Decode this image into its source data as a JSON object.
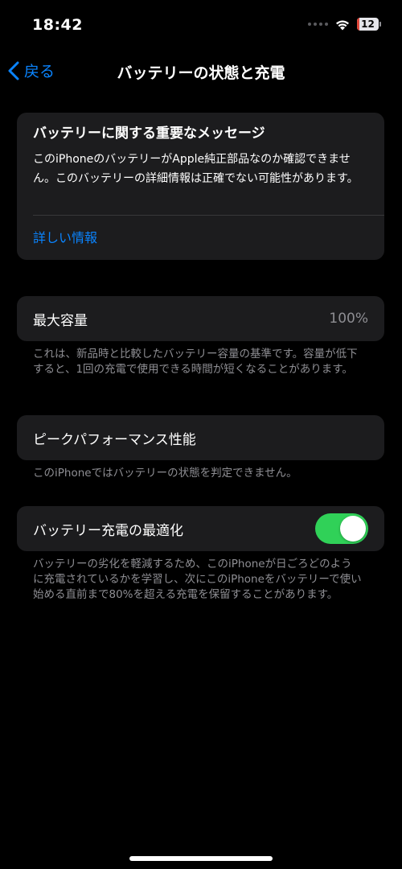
{
  "status_bar": {
    "time": "18:42",
    "battery_level": "12",
    "battery_fraction": 0.12,
    "battery_color": "#e0473a",
    "icons": [
      "cellular-dots-icon",
      "wifi-icon",
      "battery-icon"
    ]
  },
  "nav": {
    "back_label": "戻る",
    "title": "バッテリーの状態と充電",
    "back_icon": "chevron-left-icon"
  },
  "message_card": {
    "title": "バッテリーに関する重要なメッセージ",
    "body": "このiPhoneのバッテリーがApple純正部品なのか確認できません。このバッテリーの詳細情報は正確でない可能性があります。",
    "link_label": "詳しい情報"
  },
  "max_capacity": {
    "label": "最大容量",
    "value": "100%",
    "note": "これは、新品時と比較したバッテリー容量の基準です。容量が低下すると、1回の充電で使用できる時間が短くなることがあります。"
  },
  "peak_performance": {
    "label": "ピークパフォーマンス性能",
    "note": "このiPhoneではバッテリーの状態を判定できません。"
  },
  "optimized_charging": {
    "label": "バッテリー充電の最適化",
    "enabled": true,
    "note": "バッテリーの劣化を軽減するため、このiPhoneが日ごろどのように充電されているかを学習し、次にこのiPhoneをバッテリーで使い始める直前まで80%を超える充電を保留することがあります。"
  },
  "colors": {
    "background": "#000000",
    "card": "#1c1c1e",
    "accent": "#0a84ff",
    "toggle_on": "#30d158",
    "secondary_text": "#8e8e93"
  }
}
